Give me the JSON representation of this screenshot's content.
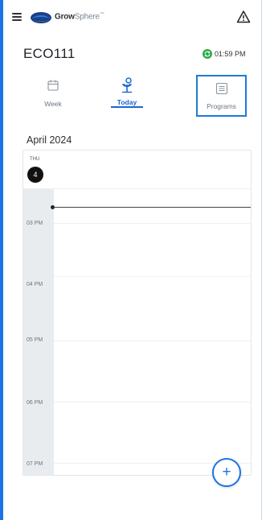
{
  "app": {
    "logo_grow": "Grow",
    "logo_sphere": "Sphere",
    "logo_tm": "™"
  },
  "device": {
    "name": "ECO111",
    "time": "01:59 PM"
  },
  "tabs": [
    {
      "label": "Week",
      "icon": "calendar-icon",
      "active": false
    },
    {
      "label": "Today",
      "icon": "plant-icon",
      "active": true
    },
    {
      "label": "Programs",
      "icon": "list-icon",
      "active": false
    }
  ],
  "calendar": {
    "month": "April 2024",
    "day_name": "THU",
    "day_number": "4",
    "hours": [
      "03 PM",
      "04 PM",
      "05 PM",
      "06 PM",
      "07 PM"
    ]
  },
  "icons": {
    "menu": "hamburger-icon",
    "alert": "warning-icon",
    "sync": "sync-icon",
    "add": "plus-icon"
  },
  "fab_label": "+",
  "colors": {
    "accent": "#1a73e8",
    "active_tab": "#1a66d2",
    "sync_green": "#2aa94a"
  }
}
